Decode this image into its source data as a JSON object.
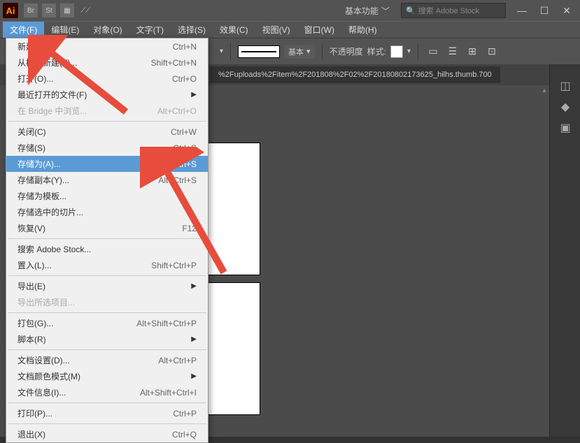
{
  "titlebar": {
    "logo": "Ai",
    "icons": [
      "Br",
      "St"
    ],
    "workspace": "基本功能",
    "search_placeholder": "搜索 Adobe Stock"
  },
  "menubar": {
    "items": [
      {
        "label": "文件(F)",
        "active": true
      },
      {
        "label": "编辑(E)",
        "active": false
      },
      {
        "label": "对象(O)",
        "active": false
      },
      {
        "label": "文字(T)",
        "active": false
      },
      {
        "label": "选择(S)",
        "active": false
      },
      {
        "label": "效果(C)",
        "active": false
      },
      {
        "label": "视图(V)",
        "active": false
      },
      {
        "label": "窗口(W)",
        "active": false
      },
      {
        "label": "帮助(H)",
        "active": false
      }
    ]
  },
  "toolbar": {
    "stroke_label": "基本",
    "opacity_label": "不透明度",
    "style_label": "样式:"
  },
  "doctab": {
    "title": "%2Fuploads%2Fitem%2F201808%2F02%2F20180802173625_hilhs.thumb.700"
  },
  "file_menu": {
    "items": [
      {
        "type": "item",
        "label": "新建(N)...",
        "shortcut": "Ctrl+N"
      },
      {
        "type": "item",
        "label": "从模板新建(T)...",
        "shortcut": "Shift+Ctrl+N"
      },
      {
        "type": "item",
        "label": "打开(O)...",
        "shortcut": "Ctrl+O"
      },
      {
        "type": "item",
        "label": "最近打开的文件(F)",
        "shortcut": "",
        "submenu": true
      },
      {
        "type": "item",
        "label": "在 Bridge 中浏览...",
        "shortcut": "Alt+Ctrl+O",
        "disabled": true
      },
      {
        "type": "sep"
      },
      {
        "type": "item",
        "label": "关闭(C)",
        "shortcut": "Ctrl+W"
      },
      {
        "type": "item",
        "label": "存储(S)",
        "shortcut": "Ctrl+S"
      },
      {
        "type": "item",
        "label": "存储为(A)...",
        "shortcut": "Shift+Ctrl+S",
        "highlighted": true
      },
      {
        "type": "item",
        "label": "存储副本(Y)...",
        "shortcut": "Alt+Ctrl+S"
      },
      {
        "type": "item",
        "label": "存储为模板..."
      },
      {
        "type": "item",
        "label": "存储选中的切片..."
      },
      {
        "type": "item",
        "label": "恢复(V)",
        "shortcut": "F12"
      },
      {
        "type": "sep"
      },
      {
        "type": "item",
        "label": "搜索 Adobe Stock..."
      },
      {
        "type": "item",
        "label": "置入(L)...",
        "shortcut": "Shift+Ctrl+P"
      },
      {
        "type": "sep"
      },
      {
        "type": "item",
        "label": "导出(E)",
        "submenu": true
      },
      {
        "type": "item",
        "label": "导出所选项目...",
        "disabled": true
      },
      {
        "type": "sep"
      },
      {
        "type": "item",
        "label": "打包(G)...",
        "shortcut": "Alt+Shift+Ctrl+P"
      },
      {
        "type": "item",
        "label": "脚本(R)",
        "submenu": true
      },
      {
        "type": "sep"
      },
      {
        "type": "item",
        "label": "文档设置(D)...",
        "shortcut": "Alt+Ctrl+P"
      },
      {
        "type": "item",
        "label": "文档颜色模式(M)",
        "submenu": true
      },
      {
        "type": "item",
        "label": "文件信息(I)...",
        "shortcut": "Alt+Shift+Ctrl+I"
      },
      {
        "type": "sep"
      },
      {
        "type": "item",
        "label": "打印(P)...",
        "shortcut": "Ctrl+P"
      },
      {
        "type": "sep"
      },
      {
        "type": "item",
        "label": "退出(X)",
        "shortcut": "Ctrl+Q"
      }
    ]
  }
}
